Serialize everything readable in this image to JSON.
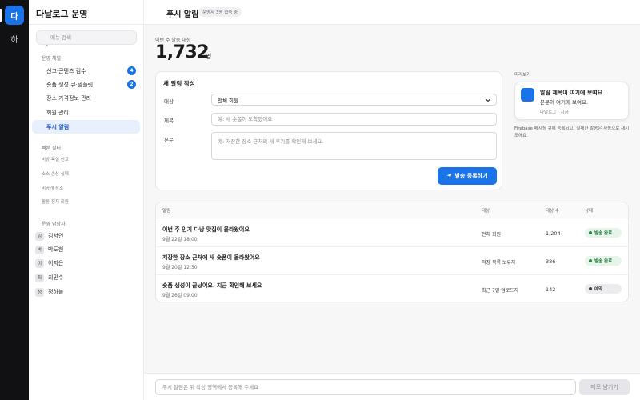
{
  "rail": {
    "active_label": "다",
    "second_label": "하"
  },
  "sidebar": {
    "title": "다날로그 운영",
    "search_placeholder": "메뉴 검색",
    "channels_heading": "운영 채널",
    "items": [
      {
        "label": "신고·콘텐츠 검수",
        "badge": "4"
      },
      {
        "label": "숏폼 생성 큐·템플릿",
        "badge": "2"
      },
      {
        "label": "장소·가격정보 관리"
      },
      {
        "label": "회원 관리"
      },
      {
        "label": "푸시 알림"
      }
    ],
    "filters_heading": "빠른 필터",
    "filters": [
      "비방·욕설 신고",
      "소스 손상 실패",
      "비공개 장소",
      "활동 정지 회원"
    ],
    "staff_heading": "운영 담당자",
    "staff": [
      {
        "initial": "김",
        "name": "김서연"
      },
      {
        "initial": "박",
        "name": "박도현"
      },
      {
        "initial": "이",
        "name": "이지은"
      },
      {
        "initial": "최",
        "name": "최민수"
      },
      {
        "initial": "정",
        "name": "정하늘"
      }
    ]
  },
  "header": {
    "title": "푸시 알림",
    "online": "운영자 3명 접속 중"
  },
  "stats": {
    "label": "이번 주 발송 대상",
    "value": "1,732",
    "unit": "명"
  },
  "compose": {
    "title": "새 알림 작성",
    "target_label": "대상",
    "target_value": "전체 회원",
    "subject_label": "제목",
    "subject_placeholder": "예: 새 숏폼이 도착했어요",
    "body_label": "본문",
    "body_placeholder": "예: 저장한 장소 근처의 새 후기를 확인해 보세요.",
    "submit": "발송 등록하기"
  },
  "preview": {
    "label": "미리보기",
    "title": "알림 제목이 여기에 보여요",
    "body": "본문이 여기에 보여요.",
    "meta": "다날로그 · 지금",
    "note": "Firebase 메시징 큐에 등록되고, 실패한 발송은 자동으로 재시도해요."
  },
  "table": {
    "headers": {
      "title": "알림",
      "target": "대상",
      "count": "대상 수",
      "status": "상태"
    },
    "rows": [
      {
        "title": "이번 주 인기 다낭 맛집이 올라왔어요",
        "date": "9월 22일 18:00",
        "target": "전체 회원",
        "count": "1,204",
        "status": "발송 완료",
        "status_kind": "done"
      },
      {
        "title": "저장한 장소 근처에 새 숏폼이 올라왔어요",
        "date": "9월 20일 12:30",
        "target": "저장 목록 보유자",
        "count": "386",
        "status": "발송 완료",
        "status_kind": "done"
      },
      {
        "title": "숏폼 생성이 끝났어요. 지금 확인해 보세요",
        "date": "9월 26일 09:00",
        "target": "최근 7일 업로드자",
        "count": "142",
        "status": "예약",
        "status_kind": "scheduled"
      }
    ]
  },
  "bottom": {
    "memo_placeholder": "푸시 알림은 위 작성 영역에서 등록해 주세요",
    "memo_button": "메모 남기기"
  },
  "colors": {
    "accent": "#1a73e8",
    "done_bg": "#e6f4ea",
    "done_text": "#137333",
    "done_dot": "#1e8e3e",
    "scheduled_bg": "#ececef",
    "scheduled_text": "#3a3a3c",
    "scheduled_dot": "#3a3a3c"
  }
}
